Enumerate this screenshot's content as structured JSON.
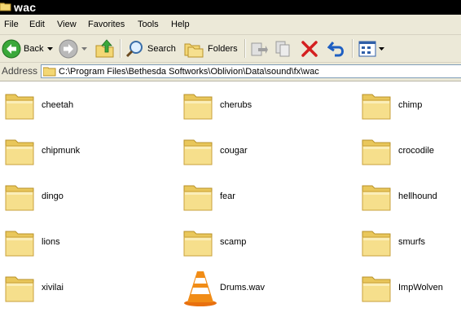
{
  "window": {
    "title": "wac"
  },
  "menu": [
    "File",
    "Edit",
    "View",
    "Favorites",
    "Tools",
    "Help"
  ],
  "toolbar": {
    "back_label": "Back",
    "search_label": "Search",
    "folders_label": "Folders"
  },
  "address": {
    "label": "Address",
    "path": "C:\\Program Files\\Bethesda Softworks\\Oblivion\\Data\\sound\\fx\\wac"
  },
  "files": [
    {
      "name": "cheetah",
      "type": "folder-icon"
    },
    {
      "name": "cherubs",
      "type": "folder-icon"
    },
    {
      "name": "chimp",
      "type": "folder-icon"
    },
    {
      "name": "chipmunk",
      "type": "folder-icon"
    },
    {
      "name": "cougar",
      "type": "folder-icon"
    },
    {
      "name": "crocodile",
      "type": "folder-icon"
    },
    {
      "name": "dingo",
      "type": "folder-icon"
    },
    {
      "name": "fear",
      "type": "folder-icon"
    },
    {
      "name": "hellhound",
      "type": "folder-icon"
    },
    {
      "name": "lions",
      "type": "folder-icon"
    },
    {
      "name": "scamp",
      "type": "folder-icon"
    },
    {
      "name": "smurfs",
      "type": "folder-icon"
    },
    {
      "name": "xivilai",
      "type": "folder-icon"
    },
    {
      "name": "Drums.wav",
      "type": "vlc-cone-icon"
    },
    {
      "name": "ImpWolven",
      "type": "folder-icon"
    }
  ]
}
